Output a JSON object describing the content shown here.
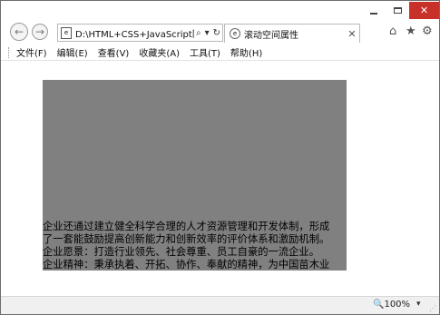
{
  "window": {
    "min_label": "",
    "max_label": "",
    "close_label": "✕"
  },
  "nav": {
    "back_glyph": "←",
    "forward_glyph": "→",
    "address": "D:\\HTML+CSS+JavaScript网",
    "search_glyph": "⌕",
    "dropdown_glyph": "▾",
    "refresh_glyph": "↻"
  },
  "tab": {
    "title": "滚动空间属性",
    "close_glyph": "✕"
  },
  "toolbar_icons": {
    "home": "⌂",
    "favorites": "★",
    "tools": "⚙"
  },
  "menu": [
    "文件(F)",
    "编辑(E)",
    "查看(V)",
    "收藏夹(A)",
    "工具(T)",
    "帮助(H)"
  ],
  "content": {
    "box_color": "#808080",
    "lines": [
      "企业还通过建立健全科学合理的人才资源管理和开发体制，形成",
      "了一套能鼓励提高创新能力和创新效率的评价体系和激励机制。",
      "企业愿景：打造行业领先、社会尊重、员工自豪的一流企业。",
      "企业精神：秉承执着、开拓、协作、奉献的精神，为中国苗木业"
    ]
  },
  "status": {
    "zoom_label": "🔍100%",
    "zoom_dropdown": "▾"
  },
  "colors": {
    "close_button": "#c7312a",
    "content_box": "#808080"
  }
}
